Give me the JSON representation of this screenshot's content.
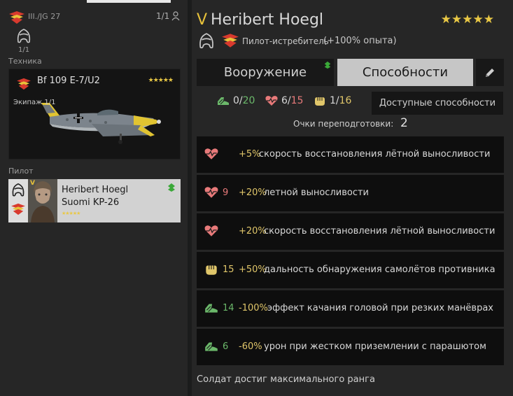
{
  "unit": {
    "name": "III./JG 27",
    "crew_count": "1/1",
    "pilot_slot_count": "1/1"
  },
  "sections": {
    "vehicle": "Техника",
    "pilot": "Пилот"
  },
  "plane": {
    "name": "Bf 109 E-7/U2",
    "stars": "★★★★★",
    "crew_label": "Экипаж 1/1"
  },
  "pilot_card": {
    "rank": "V",
    "name": "Heribert Hoegl",
    "plane": "Suomi KP-26",
    "stars": "★★★★★"
  },
  "pilot": {
    "rank": "V",
    "name": "Heribert Hoegl",
    "stars": "★★★★★",
    "class": "Пилот-истребитель",
    "exp_bonus": "(+100% опыта)"
  },
  "tabs": {
    "weapons": "Вооружение",
    "abilities": "Способности"
  },
  "stats": {
    "agility": {
      "current": "0",
      "sep": "/",
      "max": "20"
    },
    "stamina": {
      "current": "6",
      "sep": "/",
      "max": "15"
    },
    "perception": {
      "current": "1",
      "sep": "/",
      "max": "16"
    }
  },
  "available_button": "Доступные способности",
  "retrain": {
    "label": "Очки переподготовки:",
    "value": "2"
  },
  "perks": [
    {
      "icon": "heart",
      "cost": "",
      "value": "+5%",
      "text": "скорость восстановления лётной выносливости"
    },
    {
      "icon": "heart",
      "cost": "9",
      "value": "+20%",
      "text": "летной выносливости"
    },
    {
      "icon": "heart",
      "cost": "",
      "value": "+20%",
      "text": "скорость восстановления лётной выносливости"
    },
    {
      "icon": "fist",
      "cost": "15",
      "value": "+50%",
      "text": "дальность обнаружения самолётов противника"
    },
    {
      "icon": "shoe",
      "cost": "14",
      "value": "-100%",
      "text": "эффект качания головой при резких манёврах"
    },
    {
      "icon": "shoe",
      "cost": "6",
      "value": "-60%",
      "text": "урон при жестком приземлении с парашютом"
    }
  ],
  "max_rank_note": "Солдат достиг максимального ранга",
  "colors": {
    "accent_gold": "#e8c23a",
    "stamina": "#e87a7a",
    "agility": "#6bb86a",
    "perception": "#e0c66a"
  }
}
